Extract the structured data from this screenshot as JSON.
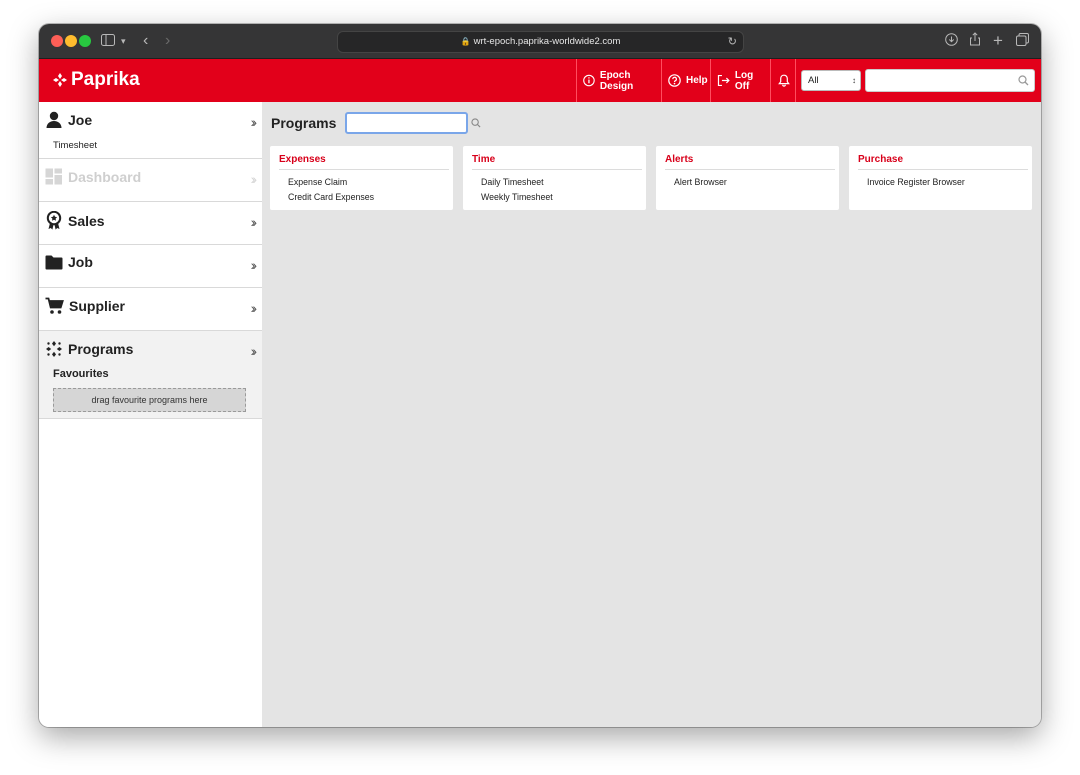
{
  "browser": {
    "url": "wrt-epoch.paprika-worldwide2.com"
  },
  "header": {
    "logo": "Paprika",
    "items": [
      {
        "label": "Epoch Design",
        "icon": "info-circle-icon"
      },
      {
        "label": "Help",
        "icon": "question-circle-icon"
      },
      {
        "label": "Log Off",
        "icon": "logout-icon"
      }
    ],
    "bell_icon": "bell-icon",
    "scope_select": {
      "value": "All"
    },
    "search": {
      "value": "",
      "placeholder": ""
    }
  },
  "sidebar": {
    "user": {
      "name": "Joe",
      "sub": "Timesheet"
    },
    "sections": [
      {
        "label": "Dashboard",
        "icon": "dashboard-icon",
        "disabled": true
      },
      {
        "label": "Sales",
        "icon": "award-badge-icon"
      },
      {
        "label": "Job",
        "icon": "folder-icon"
      },
      {
        "label": "Supplier",
        "icon": "cart-icon"
      }
    ],
    "programs": {
      "label": "Programs",
      "favourites_label": "Favourites",
      "drop_hint": "drag favourite programs here"
    }
  },
  "main": {
    "title": "Programs",
    "search": {
      "value": "",
      "placeholder": ""
    },
    "cards": [
      {
        "title": "Expenses",
        "links": [
          "Expense Claim",
          "Credit Card Expenses"
        ]
      },
      {
        "title": "Time",
        "links": [
          "Daily Timesheet",
          "Weekly Timesheet"
        ]
      },
      {
        "title": "Alerts",
        "links": [
          "Alert Browser"
        ]
      },
      {
        "title": "Purchase",
        "links": [
          "Invoice Register Browser"
        ]
      }
    ]
  },
  "colors": {
    "brand_red": "#e2001a",
    "card_title_red": "#d8001a",
    "focus_blue": "#7aa6e9"
  }
}
